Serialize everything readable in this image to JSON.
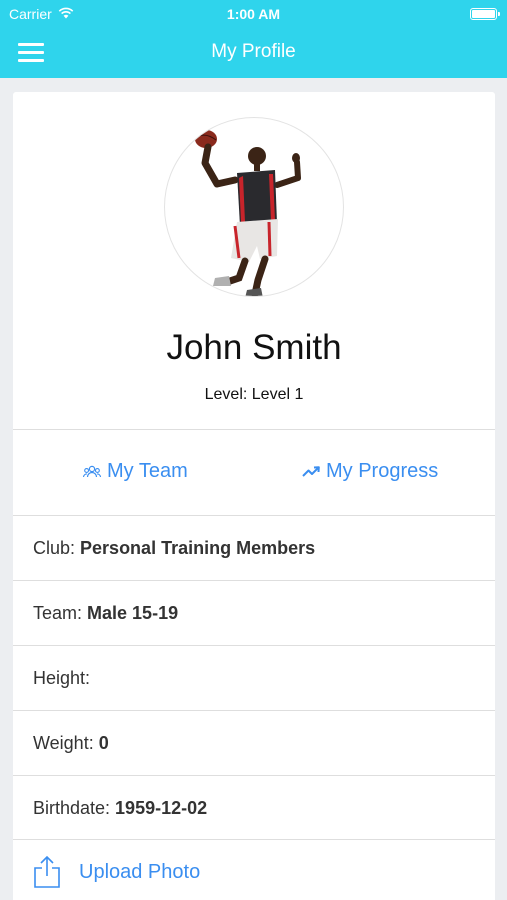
{
  "status_bar": {
    "carrier": "Carrier",
    "time": "1:00 AM"
  },
  "nav": {
    "title": "My Profile",
    "menu_icon": "hamburger-menu-icon"
  },
  "profile": {
    "name": "John Smith",
    "level_text": "Level: Level 1"
  },
  "actions": {
    "team_label": "My Team",
    "team_icon": "team-icon",
    "progress_label": "My Progress",
    "progress_icon": "trending-up-icon"
  },
  "details": {
    "club_label": "Club:",
    "club_value": "Personal Training Members",
    "team_label": "Team:",
    "team_value": "Male 15-19",
    "height_label": "Height:",
    "height_value": "",
    "weight_label": "Weight:",
    "weight_value": "0",
    "birthdate_label": "Birthdate:",
    "birthdate_value": "1959-12-02"
  },
  "upload": {
    "label": "Upload Photo",
    "icon": "share-upload-icon"
  },
  "colors": {
    "header": "#2fd4ec",
    "link": "#3a8ef0",
    "background": "#eceef1"
  }
}
